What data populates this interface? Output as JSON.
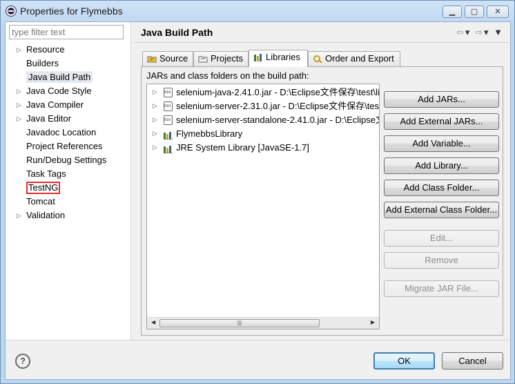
{
  "window": {
    "title": "Properties for Flymebbs",
    "controls": [
      "minimize",
      "maximize",
      "close"
    ]
  },
  "filter": {
    "placeholder": "type filter text"
  },
  "tree": [
    {
      "label": "Resource",
      "expandable": true
    },
    {
      "label": "Builders",
      "expandable": false
    },
    {
      "label": "Java Build Path",
      "expandable": false,
      "selected": true
    },
    {
      "label": "Java Code Style",
      "expandable": true
    },
    {
      "label": "Java Compiler",
      "expandable": true
    },
    {
      "label": "Java Editor",
      "expandable": true
    },
    {
      "label": "Javadoc Location",
      "expandable": false
    },
    {
      "label": "Project References",
      "expandable": false
    },
    {
      "label": "Run/Debug Settings",
      "expandable": false
    },
    {
      "label": "Task Tags",
      "expandable": false
    },
    {
      "label": "TestNG",
      "expandable": false,
      "highlighted": true
    },
    {
      "label": "Tomcat",
      "expandable": false
    },
    {
      "label": "Validation",
      "expandable": true
    }
  ],
  "page": {
    "title": "Java Build Path",
    "tabs": [
      {
        "label": "Source",
        "icon": "source-folder-icon"
      },
      {
        "label": "Projects",
        "icon": "projects-icon"
      },
      {
        "label": "Libraries",
        "icon": "libraries-icon",
        "active": true
      },
      {
        "label": "Order and Export",
        "icon": "order-export-icon"
      }
    ],
    "list_label": "JARs and class folders on the build path:",
    "entries": [
      {
        "label": "selenium-java-2.41.0.jar - D:\\Eclipse文件保存\\test\\li",
        "icon": "jar-icon"
      },
      {
        "label": "selenium-server-2.31.0.jar - D:\\Eclipse文件保存\\test",
        "icon": "jar-icon"
      },
      {
        "label": "selenium-server-standalone-2.41.0.jar - D:\\Eclipse文",
        "icon": "jar-icon"
      },
      {
        "label": "FlymebbsLibrary",
        "icon": "library-icon"
      },
      {
        "label": "JRE System Library [JavaSE-1.7]",
        "icon": "library-icon"
      }
    ],
    "buttons": [
      {
        "label": "Add JARs...",
        "enabled": true
      },
      {
        "label": "Add External JARs...",
        "enabled": true
      },
      {
        "label": "Add Variable...",
        "enabled": true
      },
      {
        "label": "Add Library...",
        "enabled": true
      },
      {
        "label": "Add Class Folder...",
        "enabled": true
      },
      {
        "label": "Add External Class Folder...",
        "enabled": true
      },
      {
        "label": "Edit...",
        "enabled": false
      },
      {
        "label": "Remove",
        "enabled": false
      },
      {
        "label": "Migrate JAR File...",
        "enabled": false
      }
    ]
  },
  "dialog": {
    "ok_label": "OK",
    "cancel_label": "Cancel",
    "help_label": "?"
  }
}
